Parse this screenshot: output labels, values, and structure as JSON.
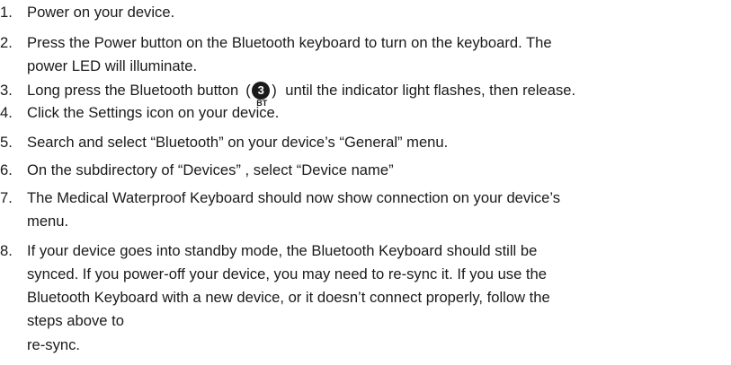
{
  "steps": [
    {
      "num": "1.",
      "lines": [
        "Power on your device."
      ]
    },
    {
      "num": "2.",
      "lines": [
        "Press the Power button on the Bluetooth keyboard to turn on the keyboard. The",
        "power LED will illuminate."
      ]
    },
    {
      "num": "3.",
      "pre": "Long press the Bluetooth button",
      "post": "until the indicator light flashes, then release."
    },
    {
      "num": "4.",
      "lines": [
        "Click the Settings icon on your device."
      ]
    },
    {
      "num": "5.",
      "lines": [
        "Search and select “Bluetooth” on your device’s “General” menu."
      ]
    },
    {
      "num": "6.",
      "lines": [
        "On the subdirectory of “Devices” , select “Device name”"
      ]
    },
    {
      "num": "7.",
      "lines": [
        "The Medical Waterproof Keyboard should now show connection on your device’s",
        "menu."
      ]
    },
    {
      "num": "8.",
      "lines": [
        "If your device goes into standby mode, the Bluetooth Keyboard should still be",
        "synced. If you power-off your device, you may need to re-sync it. If you use the",
        "Bluetooth Keyboard with a new device, or it doesn’t connect properly, follow the",
        "steps above to",
        "re-sync."
      ]
    }
  ],
  "bt_icon": {
    "digit": "3",
    "sub": "BT",
    "paren_left": "(",
    "paren_right": ")"
  }
}
